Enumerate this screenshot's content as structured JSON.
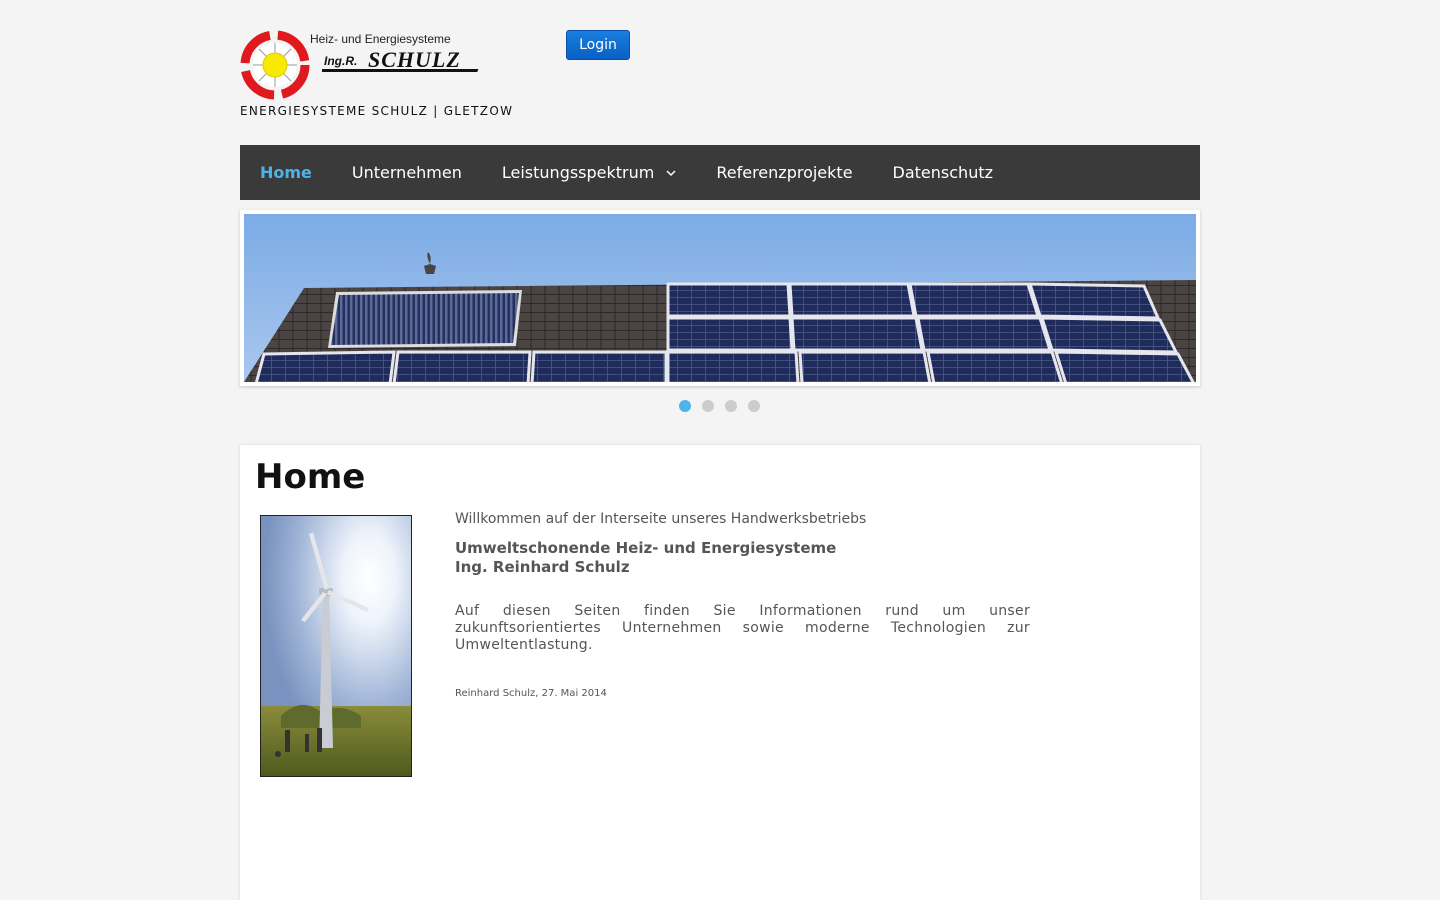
{
  "header": {
    "logo_top_text": "Heiz- und Energiesysteme",
    "logo_brand_prefix": "Ing.R.",
    "logo_brand_name": "SCHULZ",
    "tagline": "ENERGIESYSTEME SCHULZ | GLETZOW",
    "login_label": "Login",
    "login_color": "#0a5fc4"
  },
  "nav": {
    "items": [
      {
        "label": "Home",
        "active": true
      },
      {
        "label": "Unternehmen"
      },
      {
        "label": "Leistungsspektrum",
        "has_dropdown": true
      },
      {
        "label": "Referenzprojekte"
      },
      {
        "label": "Datenschutz"
      }
    ],
    "background": "#3a3a3a",
    "active_color": "#4db4e8"
  },
  "slider": {
    "slide_count": 4,
    "active_index": 0
  },
  "content": {
    "title": "Home",
    "welcome": "Willkommen auf der Interseite unseres Handwerksbetriebs",
    "heading_line1": "Umweltschonende Heiz- und Energiesysteme",
    "heading_line2": "Ing. Reinhard Schulz",
    "body": "Auf diesen Seiten finden Sie Informationen rund um unser zukunftsorientiertes Unternehmen sowie moderne Technologien zur Umweltentlastung.",
    "signature": "Reinhard Schulz, 27. Mai 2014"
  }
}
